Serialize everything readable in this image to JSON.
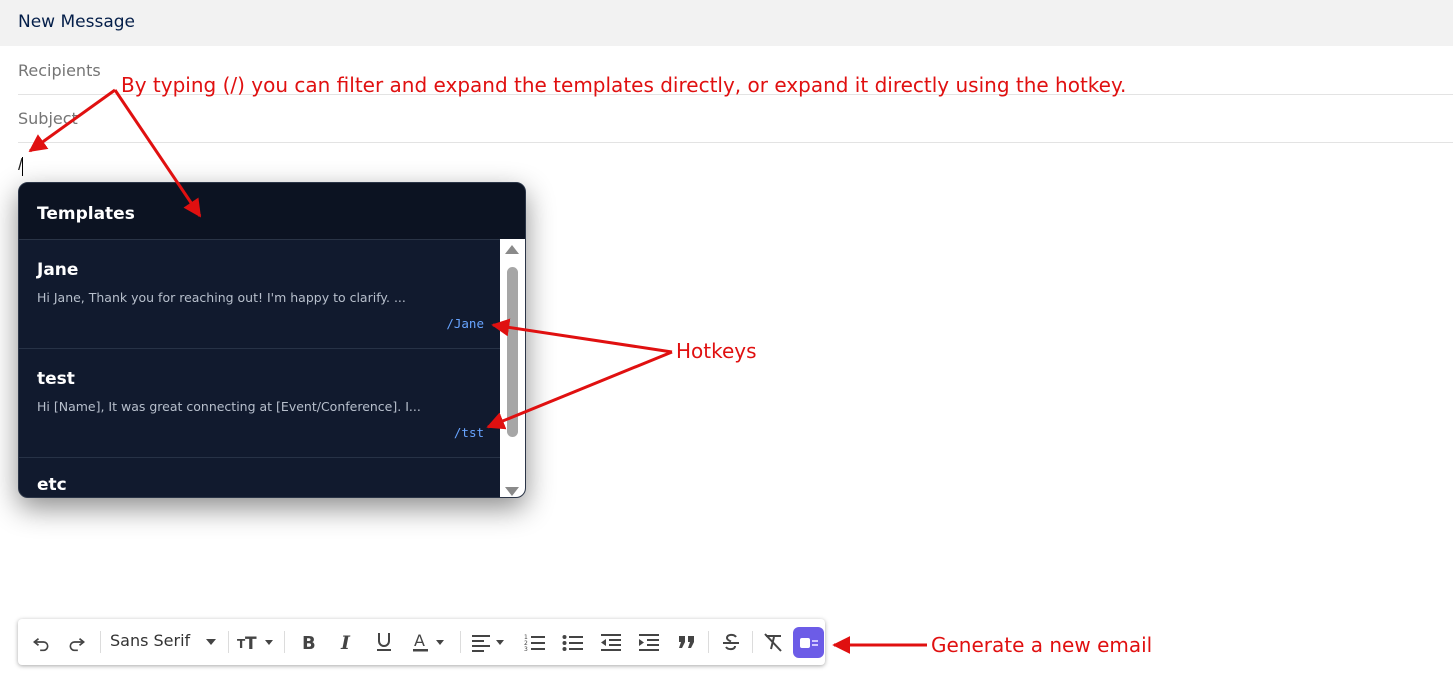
{
  "header": {
    "title": "New Message"
  },
  "compose": {
    "recipients_placeholder": "Recipients",
    "subject_placeholder": "Subject",
    "body_text": "/"
  },
  "templates_popup": {
    "title": "Templates",
    "items": [
      {
        "name": "Jane",
        "preview": "Hi Jane, Thank you for reaching out! I'm happy to clarify. ...",
        "hotkey": "/Jane"
      },
      {
        "name": "test",
        "preview": "Hi [Name], It was great connecting at [Event/Conference]. I...",
        "hotkey": "/tst"
      },
      {
        "name": "etc",
        "preview": "",
        "hotkey": ""
      }
    ]
  },
  "toolbar": {
    "font_family": "Sans Serif",
    "icons": [
      "undo-icon",
      "redo-icon",
      "font-size-icon",
      "bold-icon",
      "italic-icon",
      "underline-icon",
      "text-color-icon",
      "align-icon",
      "numbered-list-icon",
      "bulleted-list-icon",
      "indent-less-icon",
      "indent-more-icon",
      "quote-icon",
      "strikethrough-icon",
      "remove-formatting-icon",
      "generate-email-icon"
    ]
  },
  "annotations": {
    "filter_hint": "By typing (/) you can filter and expand the templates directly, or expand it directly using the hotkey.",
    "hotkeys": "Hotkeys",
    "generate": "Generate a new email"
  },
  "colors": {
    "annotation": "#e01010",
    "popup_bg": "#111a2e",
    "hotkey": "#67a4ff",
    "generate_button": "#6c5ce7"
  }
}
